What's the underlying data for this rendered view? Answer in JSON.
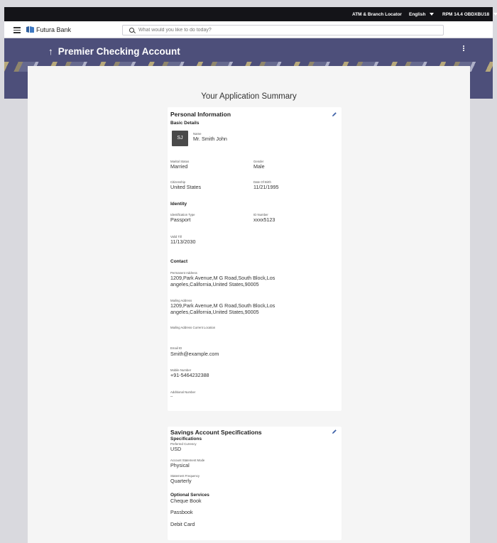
{
  "topbar": {
    "atm_label": "ATM & Branch Locator",
    "language": "English",
    "user": "RPM 14.4 OBDXBU18"
  },
  "header": {
    "brand": "Futura Bank",
    "search_placeholder": "What would you like to do today?"
  },
  "banner": {
    "title": "Premier Checking Account"
  },
  "summary": {
    "title": "Your Application Summary"
  },
  "personal": {
    "title": "Personal Information",
    "basic_details": "Basic Details",
    "avatar_initials": "SJ",
    "name_label": "Name",
    "name_value": "Mr. Smith John",
    "marital_label": "Marital Status",
    "marital_value": "Married",
    "gender_label": "Gender",
    "gender_value": "Male",
    "citizenship_label": "Citizenship",
    "citizenship_value": "United States",
    "dob_label": "Date Of Birth",
    "dob_value": "11/21/1995",
    "identity_title": "Identity",
    "id_type_label": "Identification Type",
    "id_type_value": "Passport",
    "id_number_label": "ID Number",
    "id_number_value": "xxxx5123",
    "valid_till_label": "Valid Till",
    "valid_till_value": "11/13/2030",
    "contact_title": "Contact",
    "perm_address_label": "Permanent Address",
    "perm_address_value": "1209,Park Avenue,M G Road,South Block,Los angeles,California,United States,90005",
    "mail_address_label": "Mailing Address",
    "mail_address_value": "1209,Park Avenue,M G Road,South Block,Los angeles,California,United States,90005",
    "mail_current_label": "Mailing Address Current Location",
    "email_label": "Email ID",
    "email_value": "Smith@example.com",
    "mobile_label": "Mobile Number",
    "mobile_value": "+91-5464232388",
    "additional_label": "Additional Number",
    "additional_value": "--"
  },
  "savings": {
    "title": "Savings Account Specifications",
    "spec_title": "Specifications",
    "currency_label": "Preferred Currency",
    "currency_value": "USD",
    "statement_mode_label": "Account Statement Mode",
    "statement_mode_value": "Physical",
    "statement_freq_label": "Statement Frequency",
    "statement_freq_value": "Quarterly",
    "optional_title": "Optional Services",
    "services": [
      "Cheque Book",
      "Passbook",
      "Debit Card"
    ]
  },
  "colors": {
    "banner": "#4d4f7a",
    "topbar": "#141418",
    "edit_icon": "#3f62a8"
  }
}
